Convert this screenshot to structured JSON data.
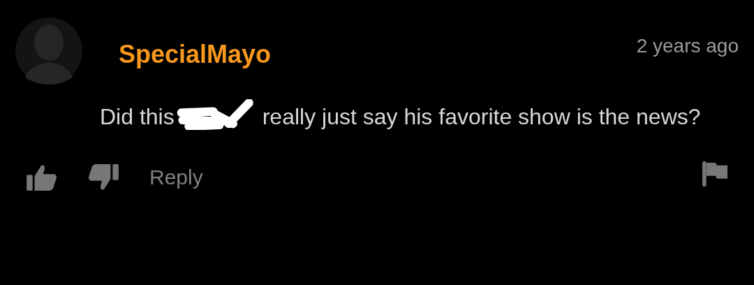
{
  "author": {
    "name": "SpecialMayo"
  },
  "time": "2 years ago",
  "comment": {
    "parts": [
      "Did this",
      "really just say his favorite show is the news?"
    ]
  },
  "actions": {
    "reply": "Reply"
  }
}
